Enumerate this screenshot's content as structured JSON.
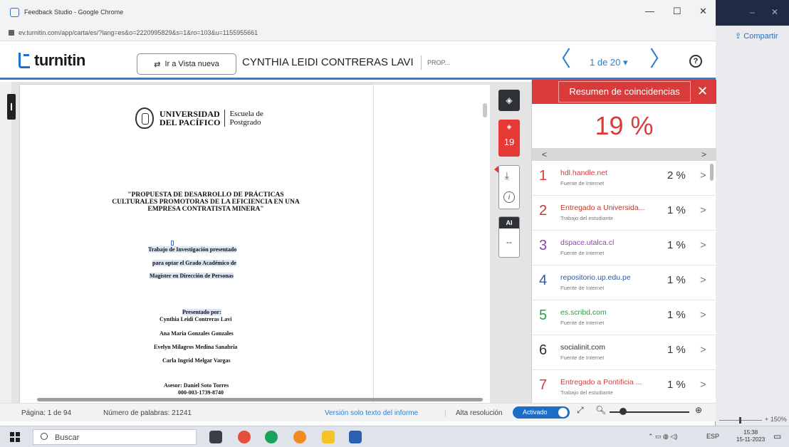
{
  "browser": {
    "window_title": "Feedback Studio - Google Chrome",
    "url": "ev.turnitin.com/app/carta/es/?lang=es&o=2220995829&s=1&ro=103&u=1155955661",
    "minimize": "—",
    "maximize": "☐",
    "close": "✕"
  },
  "desktop": {
    "share_label": "⇪ Compartir",
    "zoom_text": "+ 150%"
  },
  "header": {
    "logo_text": "turnitin",
    "new_view_button": "Ir a Vista nueva",
    "student_name": "CYNTHIA LEIDI CONTRERAS LAVI",
    "prop_text": "PROP...",
    "pager": "1 de 20 ▾",
    "prev_arrow": "〈",
    "next_arrow": "〉",
    "help": "?"
  },
  "document": {
    "university_name_1": "UNIVERSIDAD",
    "university_name_2": "DEL PACÍFICO",
    "school_1": "Escuela de",
    "school_2": "Postgrado",
    "title_1": "\"PROPUESTA DE DESARROLLO DE PRÁCTICAS",
    "title_2": "CULTURALES PROMOTORAS DE LA EFICIENCIA EN UNA",
    "title_3": "EMPRESA CONTRATISTA MINERA\"",
    "work_1": "Trabajo de Investigación presentado",
    "work_2": "para optar el Grado Académico de",
    "work_3": "Magíster en Dirección de Personas",
    "presented_by": "Presentado por:",
    "author_1": "Cynthia Leidi Contreras Lavi",
    "author_2": "Ana Maria Gonzales Gonzales",
    "author_3": "Evelyn Milagros Medina Sanabria",
    "author_4": "Carla Ingrid Melgar Vargas",
    "advisor": "Asesor: Daniel Soto Torres",
    "advisor_id": "000-003-1739-8740"
  },
  "toolbar": {
    "layers_icon": "layers-icon",
    "score_number": "19",
    "download_icon": "⤓",
    "info_icon": "i",
    "ai_label": "AI",
    "ai_value": "--"
  },
  "panel": {
    "title": "Resumen de coincidencias",
    "close": "✕",
    "overall_percent": "19 %",
    "nav_left": "<",
    "nav_right": ">",
    "matches": [
      {
        "num": "1",
        "source": "hdl.handle.net",
        "type": "Fuente de Internet",
        "percent": "2 %",
        "color": "#d93b3b"
      },
      {
        "num": "2",
        "source": "Entregado a Universida...",
        "type": "Trabajo del estudiante",
        "percent": "1 %",
        "color": "#c0392b"
      },
      {
        "num": "3",
        "source": "dspace.utalca.cl",
        "type": "Fuente de Internet",
        "percent": "1 %",
        "color": "#8e44ad"
      },
      {
        "num": "4",
        "source": "repositorio.up.edu.pe",
        "type": "Fuente de Internet",
        "percent": "1 %",
        "color": "#2c5aa0"
      },
      {
        "num": "5",
        "source": "es.scribd.com",
        "type": "Fuente de Internet",
        "percent": "1 %",
        "color": "#27a045"
      },
      {
        "num": "6",
        "source": "socialinit.com",
        "type": "Fuente de Internet",
        "percent": "1 %",
        "color": "#333333"
      },
      {
        "num": "7",
        "source": "Entregado a Pontificia ...",
        "type": "Trabajo del estudiante",
        "percent": "1 %",
        "color": "#d93b3b"
      }
    ]
  },
  "status": {
    "page": "Página: 1 de 94",
    "words": "Número de palabras: 21241",
    "text_only": "Versión solo texto del informe",
    "high_res": "Alta resolución",
    "toggle": "Activado"
  },
  "taskbar": {
    "search_placeholder": "Buscar",
    "lang": "ESP",
    "time": "15:38",
    "date": "15-11-2023"
  }
}
